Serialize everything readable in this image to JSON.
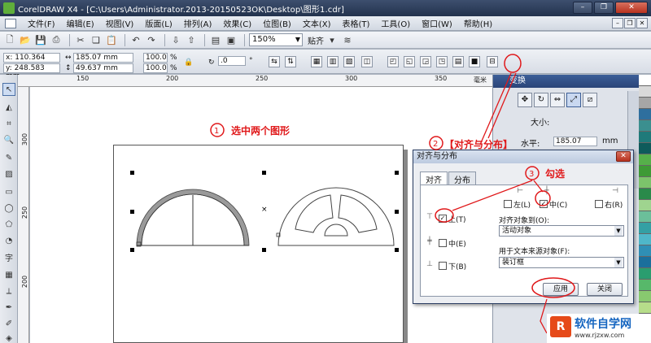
{
  "window": {
    "title": "CorelDRAW X4 - [C:\\Users\\Administrator.2013-20150523OK\\Desktop\\图形1.cdr]"
  },
  "menu": [
    "文件(F)",
    "编辑(E)",
    "视图(V)",
    "版面(L)",
    "排列(A)",
    "效果(C)",
    "位图(B)",
    "文本(X)",
    "表格(T)",
    "工具(O)",
    "窗口(W)",
    "帮助(H)"
  ],
  "toolbar": {
    "zoom": "150%",
    "snap_label": "贴齐"
  },
  "propbar": {
    "x": "x: 110.364 mm",
    "y": "y: 248.583 mm",
    "w": "185.07 mm",
    "h": "49.637 mm",
    "sx": "100.0",
    "sy": "100.0",
    "pct": "%",
    "angle": ".0",
    "deg": "°"
  },
  "ruler": {
    "top": [
      "150",
      "200",
      "250",
      "300",
      "350"
    ],
    "left": [
      "300",
      "250",
      "200"
    ],
    "unit": "毫米"
  },
  "docker": {
    "title": "变换",
    "size_label": "大小:",
    "horiz_label": "水平:",
    "horiz_value": "185.07",
    "unit": "mm"
  },
  "dialog": {
    "title": "对齐与分布",
    "tabs": [
      "对齐",
      "分布"
    ],
    "left_label": "左(L)",
    "center_h_label": "中(C)",
    "right_label": "右(R)",
    "top_label": "上(T)",
    "middle_label": "中(E)",
    "bottom_label": "下(B)",
    "align_to_label": "对齐对象到(O):",
    "align_to_value": "活动对象",
    "text_source_label": "用于文本来源对象(F):",
    "text_source_value": "装订框",
    "apply": "应用",
    "close": "关闭"
  },
  "annotations": {
    "step1": "选中两个图形",
    "step2": "【对齐与分布】",
    "step3": "勾选"
  },
  "watermark": {
    "text": "软件自学网",
    "url": "www.rjzxw.com"
  }
}
